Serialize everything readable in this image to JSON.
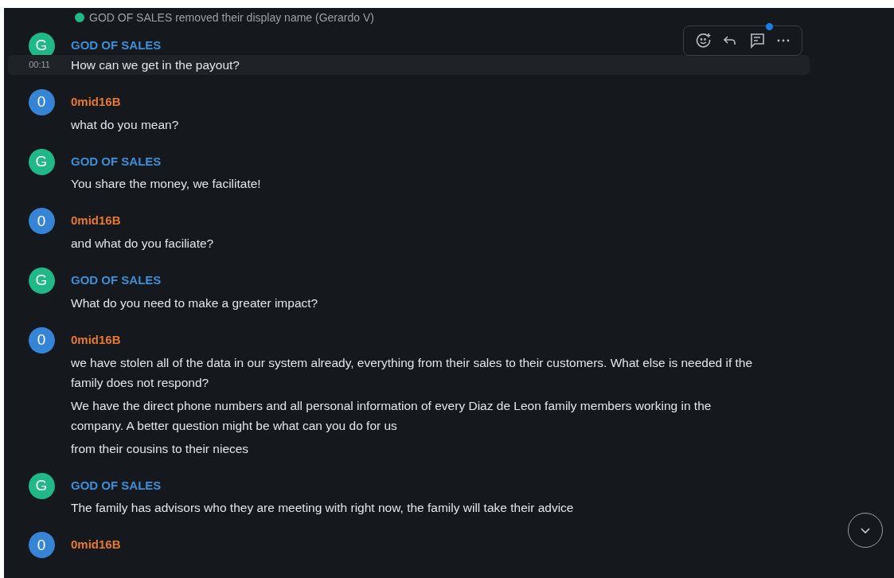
{
  "system_event": {
    "text": "GOD OF SALES removed their display name (Gerardo V)"
  },
  "messages": [
    {
      "author": "GOD OF SALES",
      "avatar": "G",
      "kind": "sales",
      "hovered": true,
      "timestamp": "00:11",
      "bodies": [
        "How can we get in the payout?"
      ]
    },
    {
      "author": "0mid16B",
      "avatar": "0",
      "kind": "member",
      "hovered": false,
      "bodies": [
        "what do you mean?"
      ]
    },
    {
      "author": "GOD OF SALES",
      "avatar": "G",
      "kind": "sales",
      "hovered": false,
      "bodies": [
        "You share the money, we facilitate!"
      ]
    },
    {
      "author": "0mid16B",
      "avatar": "0",
      "kind": "member",
      "hovered": false,
      "bodies": [
        "and what do you faciliate?"
      ]
    },
    {
      "author": "GOD OF SALES",
      "avatar": "G",
      "kind": "sales",
      "hovered": false,
      "bodies": [
        "What do you need to make a greater impact?"
      ]
    },
    {
      "author": "0mid16B",
      "avatar": "0",
      "kind": "member",
      "hovered": false,
      "bodies": [
        "we have stolen all of the data in our system already, everything from their sales to their customers. What else is needed if the family does not respond?",
        "We have the direct phone numbers and all personal information of every Diaz de Leon family members working in the company. A better question might be what can you do for us",
        "from their cousins to their nieces"
      ]
    },
    {
      "author": "GOD OF SALES",
      "avatar": "G",
      "kind": "sales",
      "hovered": false,
      "bodies": [
        "The family has advisors who they are meeting with right now, the family will take their advice"
      ]
    },
    {
      "author": "0mid16B",
      "avatar": "0",
      "kind": "member",
      "hovered": false
    }
  ],
  "toolbar": {
    "thread_unread": true
  },
  "scroll_button": {
    "visible": true
  }
}
